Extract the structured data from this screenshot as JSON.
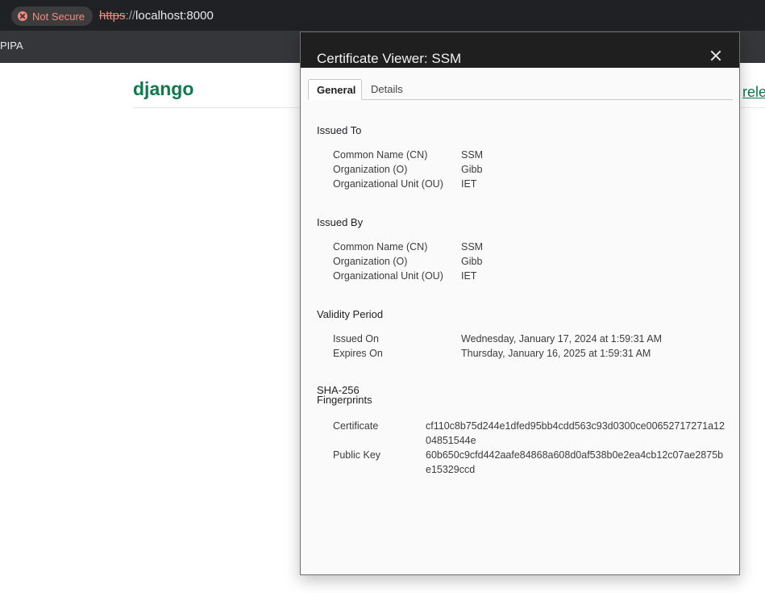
{
  "browser": {
    "security_label": "Not Secure",
    "url_scheme": "https",
    "url_sep": "://",
    "url_host": "localhost:8000",
    "bookmark": "PIPA"
  },
  "page": {
    "logo": "django",
    "link_fragment": "rele"
  },
  "dialog": {
    "title": "Certificate Viewer: SSM",
    "tabs": [
      {
        "label": "General",
        "active": true
      },
      {
        "label": "Details",
        "active": false
      }
    ],
    "issued_to": {
      "title": "Issued To",
      "rows": [
        {
          "label": "Common Name (CN)",
          "value": "SSM"
        },
        {
          "label": "Organization (O)",
          "value": "Gibb"
        },
        {
          "label": "Organizational Unit (OU)",
          "value": "IET"
        }
      ]
    },
    "issued_by": {
      "title": "Issued By",
      "rows": [
        {
          "label": "Common Name (CN)",
          "value": "SSM"
        },
        {
          "label": "Organization (O)",
          "value": "Gibb"
        },
        {
          "label": "Organizational Unit (OU)",
          "value": "IET"
        }
      ]
    },
    "validity": {
      "title": "Validity Period",
      "rows": [
        {
          "label": "Issued On",
          "value": "Wednesday, January 17, 2024 at 1:59:31 AM"
        },
        {
          "label": "Expires On",
          "value": "Thursday, January 16, 2025 at 1:59:31 AM"
        }
      ]
    },
    "fingerprints": {
      "title_line1": "SHA-256",
      "title_line2": "Fingerprints",
      "rows": [
        {
          "label": "Certificate",
          "value": "cf110c8b75d244e1dfed95bb4cdd563c93d0300ce00652717271a1204851544e"
        },
        {
          "label": "Public Key",
          "value": "60b650c9cfd442aafe84868a608d0af538b0e2ea4cb12c07ae2875be15329ccd"
        }
      ]
    }
  }
}
